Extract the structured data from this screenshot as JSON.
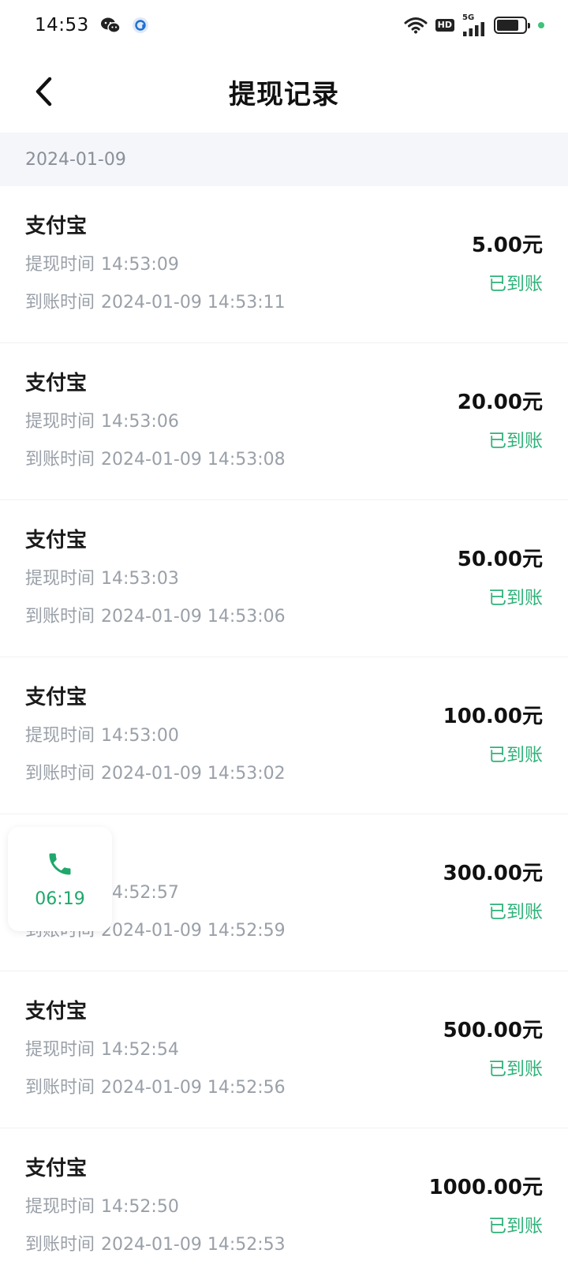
{
  "status_bar": {
    "time": "14:53",
    "hd_label": "HD",
    "network_label": "5G",
    "battery_level": 0.8
  },
  "header": {
    "title": "提现记录"
  },
  "section": {
    "date": "2024-01-09"
  },
  "labels": {
    "withdraw_time": "提现时间",
    "arrival_time": "到账时间"
  },
  "records": [
    {
      "method": "支付宝",
      "withdraw_time": "14:53:09",
      "arrival_time": "2024-01-09 14:53:11",
      "amount": "5.00元",
      "status": "已到账"
    },
    {
      "method": "支付宝",
      "withdraw_time": "14:53:06",
      "arrival_time": "2024-01-09 14:53:08",
      "amount": "20.00元",
      "status": "已到账"
    },
    {
      "method": "支付宝",
      "withdraw_time": "14:53:03",
      "arrival_time": "2024-01-09 14:53:06",
      "amount": "50.00元",
      "status": "已到账"
    },
    {
      "method": "支付宝",
      "withdraw_time": "14:53:00",
      "arrival_time": "2024-01-09 14:53:02",
      "amount": "100.00元",
      "status": "已到账"
    },
    {
      "method": "",
      "withdraw_time": "14:52:57",
      "arrival_time": "2024-01-09 14:52:59",
      "amount": "300.00元",
      "status": "已到账"
    },
    {
      "method": "支付宝",
      "withdraw_time": "14:52:54",
      "arrival_time": "2024-01-09 14:52:56",
      "amount": "500.00元",
      "status": "已到账"
    },
    {
      "method": "支付宝",
      "withdraw_time": "14:52:50",
      "arrival_time": "2024-01-09 14:52:53",
      "amount": "1000.00元",
      "status": "已到账"
    }
  ],
  "call_widget": {
    "duration": "06:19"
  },
  "colors": {
    "status_green": "#30b27a",
    "call_green": "#1fa86b",
    "date_bar_bg": "#f4f6f9"
  }
}
